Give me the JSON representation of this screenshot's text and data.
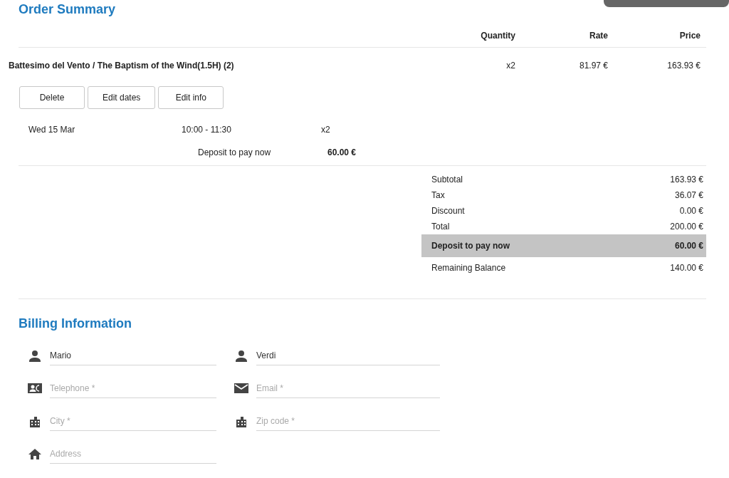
{
  "order_summary": {
    "title": "Order Summary",
    "columns": [
      "Quantity",
      "Rate",
      "Price"
    ],
    "item": {
      "name": "Battesimo del Vento / The Baptism of the Wind(1.5H) (2)",
      "quantity": "x2",
      "rate": "81.97 €",
      "price": "163.93 €"
    },
    "buttons": [
      "Delete",
      "Edit dates",
      "Edit info"
    ],
    "booking": {
      "date": "Wed 15 Mar",
      "time": "10:00 - 11:30",
      "quantity": "x2"
    },
    "item_deposit": {
      "label": "Deposit to pay now",
      "value": "60.00 €"
    },
    "totals": [
      {
        "label": "Subtotal",
        "value": "163.93 €",
        "highlighted": false
      },
      {
        "label": "Tax",
        "value": "36.07 €",
        "highlighted": false
      },
      {
        "label": "Discount",
        "value": "0.00 €",
        "highlighted": false
      },
      {
        "label": "Total",
        "value": "200.00 €",
        "highlighted": false
      },
      {
        "label": "Deposit to pay now",
        "value": "60.00 €",
        "highlighted": true
      },
      {
        "label": "Remaining Balance",
        "value": "140.00 €",
        "highlighted": false
      }
    ]
  },
  "billing": {
    "title": "Billing Information",
    "fields": [
      {
        "value": "Mario"
      },
      {
        "value": "Verdi"
      },
      {
        "placeholder": "Telephone *"
      },
      {
        "placeholder": "Email *"
      },
      {
        "placeholder": "City *"
      },
      {
        "placeholder": "Zip code *"
      },
      {
        "placeholder": "Address"
      }
    ]
  }
}
